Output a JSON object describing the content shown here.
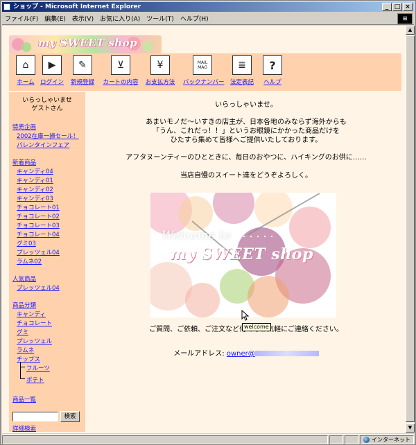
{
  "window": {
    "title": "ショップ - Microsoft Internet Explorer",
    "buttons": [
      "_",
      "□",
      "×"
    ]
  },
  "menu": [
    "ファイル(F)",
    "編集(E)",
    "表示(V)",
    "お気に入り(A)",
    "ツール(T)",
    "ヘルプ(H)"
  ],
  "banner": {
    "logo_text": "my SWEET shop"
  },
  "nav": [
    {
      "label": "ホーム",
      "icon": "house-icon"
    },
    {
      "label": "ログイン",
      "icon": "door-icon"
    },
    {
      "label": "新規登録",
      "icon": "pen-icon"
    },
    {
      "label": "カートの内容",
      "icon": "cart-icon"
    },
    {
      "label": "お支払方法",
      "icon": "yen-icon"
    },
    {
      "label": "バックナンバー",
      "icon": "magazine-icon"
    },
    {
      "label": "法定表記",
      "icon": "document-icon"
    },
    {
      "label": "ヘルプ",
      "icon": "question-icon"
    }
  ],
  "welcome": {
    "line1": "いらっしゃいませ",
    "line2": "ゲストさん"
  },
  "sidebar": {
    "special": {
      "heading": "特売企画",
      "items": [
        "2002在庫一掃セール！",
        "バレンタインフェア"
      ]
    },
    "new_products": {
      "heading": "新着商品",
      "items": [
        "キャンディ04",
        "キャンディ01",
        "キャンディ02",
        "キャンディ03",
        "チョコレート01",
        "チョコレート02",
        "チョコレート03",
        "チョコレート04",
        "グミ03",
        "プレッツェル04",
        "ラムネ02"
      ]
    },
    "popular": {
      "heading": "人気商品",
      "items": [
        "プレッツェル04"
      ]
    },
    "categories": {
      "heading": "商品分類",
      "items": [
        "キャンディ",
        "チョコレート",
        "グミ",
        "プレッツェル",
        "ラムネ",
        "チップス"
      ],
      "subitems": [
        "フルーツ",
        "ポテト"
      ]
    },
    "product_list": "商品一覧",
    "search_button": "検索",
    "advanced_search": "詳細検索"
  },
  "main": {
    "greeting": "いらっしゃいませ。",
    "intro": [
      "あまいモノだ〜いすきの店主が、日本各地のみならず海外からも",
      "「うん、これだっ！！」というお眼鏡にかかった商品だけを",
      "ひたすら集めて皆様へご提供いたしております。"
    ],
    "line2": "アフタヌーンティーのひとときに、毎日のおやつに、ハイキングのお供に……",
    "line3": "当店自慢のスイート達をどうぞよろしく。",
    "hero": {
      "welcome": "Welcome to",
      "dots": "・・・・・・",
      "shop": "my SWEET shop",
      "tooltip": "welcome"
    },
    "contact": "ご質問、ご依頼、ご注文など何でもお気軽にご連絡ください。",
    "email_label": "メールアドレス:",
    "email": "owner@"
  },
  "status": {
    "zone": "インターネット"
  },
  "colors": {
    "page_bg": "#fff4e6",
    "panel": "#ffd1ad",
    "link": "#1a1aff"
  }
}
